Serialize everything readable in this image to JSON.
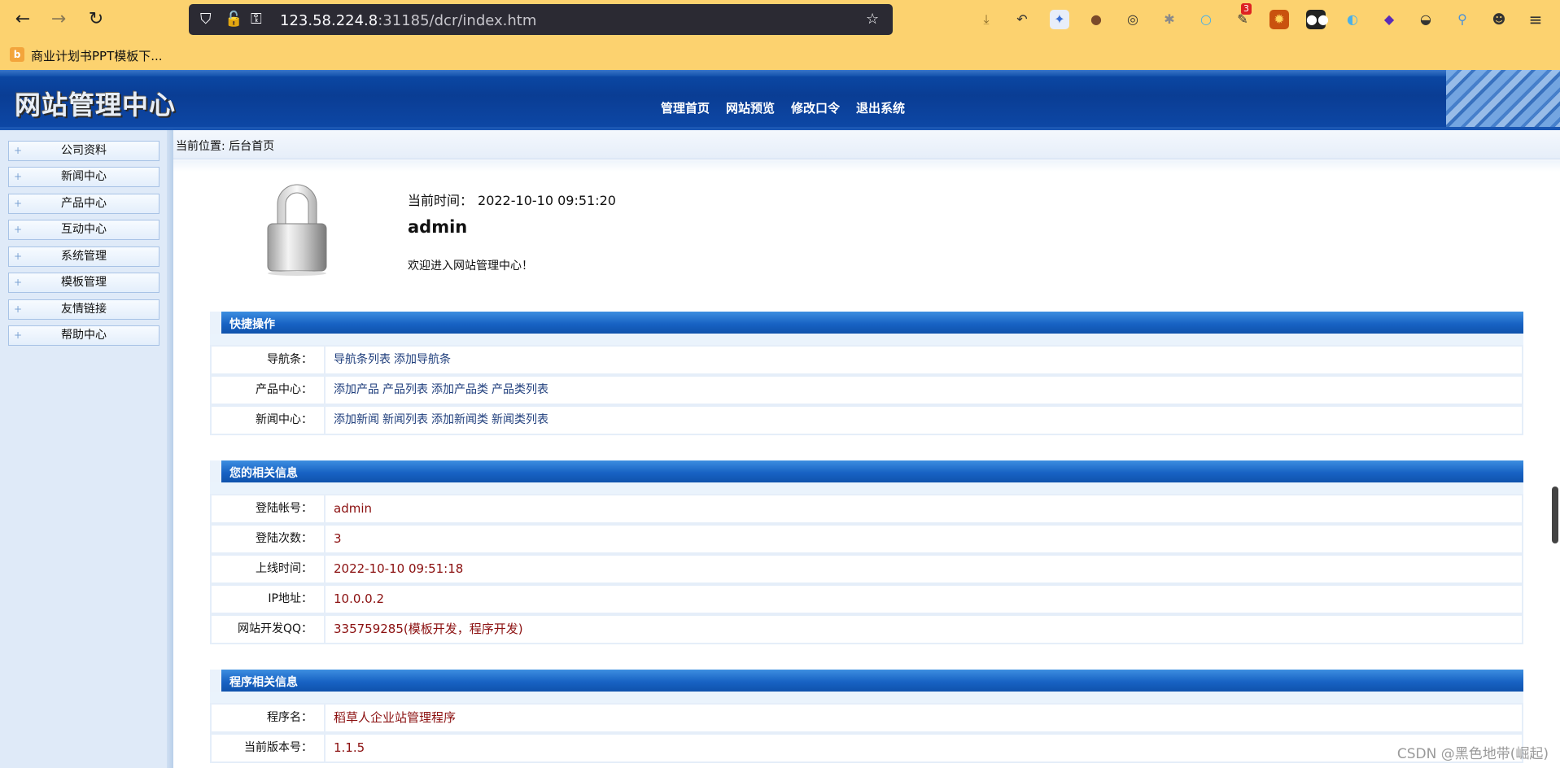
{
  "browser": {
    "url_host": "123.58.224.8",
    "url_rest": ":31185/dcr/index.htm",
    "bookmark_label": "商业计划书PPT模板下...",
    "badge_count": "3"
  },
  "site": {
    "logo": "网站管理中心",
    "nav": [
      "管理首页",
      "网站预览",
      "修改口令",
      "退出系统"
    ]
  },
  "sidebar": {
    "items": [
      "公司资料",
      "新闻中心",
      "产品中心",
      "互动中心",
      "系统管理",
      "模板管理",
      "友情链接",
      "帮助中心"
    ]
  },
  "breadcrumb": "当前位置: 后台首页",
  "welcome": {
    "time_label": "当前时间：",
    "time_value": "2022-10-10 09:51:20",
    "username": "admin",
    "message": "欢迎进入网站管理中心！"
  },
  "quick_ops": {
    "title": "快捷操作",
    "rows": [
      {
        "label": "导航条：",
        "links": [
          "导航条列表",
          "添加导航条"
        ]
      },
      {
        "label": "产品中心：",
        "links": [
          "添加产品",
          "产品列表",
          "添加产品类",
          "产品类列表"
        ]
      },
      {
        "label": "新闻中心：",
        "links": [
          "添加新闻",
          "新闻列表",
          "添加新闻类",
          "新闻类列表"
        ]
      }
    ]
  },
  "user_info": {
    "title": "您的相关信息",
    "rows": [
      {
        "label": "登陆帐号：",
        "value": "admin"
      },
      {
        "label": "登陆次数：",
        "value": "3"
      },
      {
        "label": "上线时间：",
        "value": "2022-10-10 09:51:18"
      },
      {
        "label": "IP地址：",
        "value": "10.0.0.2"
      },
      {
        "label": "网站开发QQ：",
        "value": "335759285(模板开发，程序开发)"
      }
    ]
  },
  "program_info": {
    "title": "程序相关信息",
    "rows": [
      {
        "label": "程序名：",
        "value": "稻草人企业站管理程序"
      },
      {
        "label": "当前版本号：",
        "value": "1.1.5"
      }
    ]
  },
  "watermark": "CSDN @黑色地带(崛起)"
}
